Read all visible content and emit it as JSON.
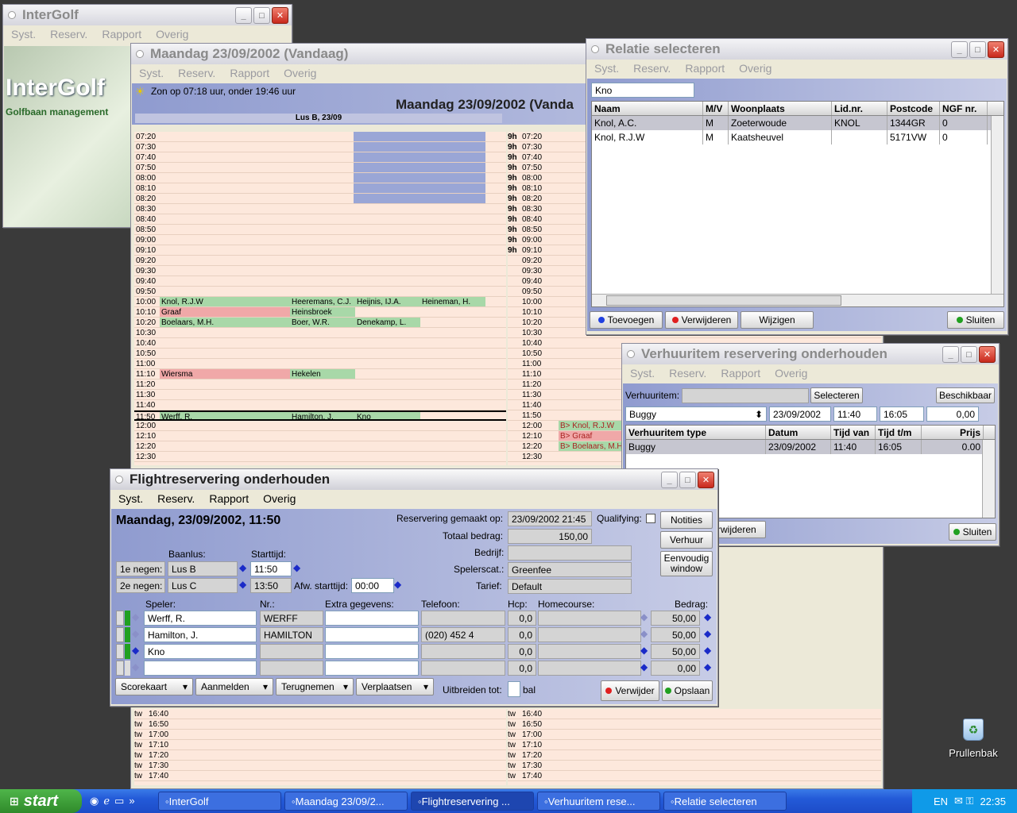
{
  "intergolf": {
    "title": "InterGolf",
    "menu": [
      "Syst.",
      "Reserv.",
      "Rapport",
      "Overig"
    ],
    "brand": "InterGolf",
    "tagline": "Golfbaan management"
  },
  "day": {
    "title": "Maandag 23/09/2002 (Vandaag)",
    "menu": [
      "Syst.",
      "Reserv.",
      "Rapport",
      "Overig"
    ],
    "sun": "Zon op 07:18 uur, onder 19:46 uur",
    "heading": "Maandag 23/09/2002 (Vanda",
    "lus_header": "Lus B, 23/09",
    "left_rows": [
      {
        "t": "07:20",
        "c": []
      },
      {
        "t": "07:30",
        "c": []
      },
      {
        "t": "07:40",
        "c": []
      },
      {
        "t": "07:50",
        "c": []
      },
      {
        "t": "08:00",
        "c": []
      },
      {
        "t": "08:10",
        "c": []
      },
      {
        "t": "08:20",
        "c": []
      },
      {
        "t": "08:30",
        "c": []
      },
      {
        "t": "08:40",
        "c": []
      },
      {
        "t": "08:50",
        "c": []
      },
      {
        "t": "09:00",
        "c": []
      },
      {
        "t": "09:10",
        "c": []
      },
      {
        "t": "09:20",
        "c": []
      },
      {
        "t": "09:30",
        "c": []
      },
      {
        "t": "09:40",
        "c": []
      },
      {
        "t": "09:50",
        "c": []
      },
      {
        "t": "10:00",
        "c": [
          "Knol, R.J.W",
          "Heeremans, C.J.",
          "Heijnis, IJ.A.",
          "Heineman, H."
        ]
      },
      {
        "t": "10:10",
        "c": [
          "Graaf",
          "Heinsbroek",
          "",
          ""
        ]
      },
      {
        "t": "10:20",
        "c": [
          "Boelaars, M.H.",
          "Boer, W.R.",
          "Denekamp, L.",
          ""
        ]
      },
      {
        "t": "10:30",
        "c": []
      },
      {
        "t": "10:40",
        "c": []
      },
      {
        "t": "10:50",
        "c": []
      },
      {
        "t": "11:00",
        "c": []
      },
      {
        "t": "11:10",
        "c": [
          "Wiersma",
          "Hekelen",
          "",
          ""
        ]
      },
      {
        "t": "11:20",
        "c": []
      },
      {
        "t": "11:30",
        "c": []
      },
      {
        "t": "11:40",
        "c": []
      },
      {
        "t": "11:50",
        "c": [
          "Werff, R.",
          "Hamilton, J.",
          "Kno",
          ""
        ]
      },
      {
        "t": "12:00",
        "c": []
      },
      {
        "t": "12:10",
        "c": []
      },
      {
        "t": "12:20",
        "c": []
      },
      {
        "t": "12:30",
        "c": []
      }
    ],
    "right_rows": [
      {
        "p": "9h",
        "t": "07:20",
        "n": ""
      },
      {
        "p": "9h",
        "t": "07:30",
        "n": ""
      },
      {
        "p": "9h",
        "t": "07:40",
        "n": ""
      },
      {
        "p": "9h",
        "t": "07:50",
        "n": ""
      },
      {
        "p": "9h",
        "t": "08:00",
        "n": ""
      },
      {
        "p": "9h",
        "t": "08:10",
        "n": ""
      },
      {
        "p": "9h",
        "t": "08:20",
        "n": ""
      },
      {
        "p": "9h",
        "t": "08:30",
        "n": ""
      },
      {
        "p": "9h",
        "t": "08:40",
        "n": ""
      },
      {
        "p": "9h",
        "t": "08:50",
        "n": ""
      },
      {
        "p": "9h",
        "t": "09:00",
        "n": ""
      },
      {
        "p": "9h",
        "t": "09:10",
        "n": ""
      },
      {
        "p": "",
        "t": "09:20",
        "n": ""
      },
      {
        "p": "",
        "t": "09:30",
        "n": ""
      },
      {
        "p": "",
        "t": "09:40",
        "n": ""
      },
      {
        "p": "",
        "t": "09:50",
        "n": ""
      },
      {
        "p": "",
        "t": "10:00",
        "n": ""
      },
      {
        "p": "",
        "t": "10:10",
        "n": ""
      },
      {
        "p": "",
        "t": "10:20",
        "n": ""
      },
      {
        "p": "",
        "t": "10:30",
        "n": ""
      },
      {
        "p": "",
        "t": "10:40",
        "n": ""
      },
      {
        "p": "",
        "t": "10:50",
        "n": ""
      },
      {
        "p": "",
        "t": "11:00",
        "n": ""
      },
      {
        "p": "",
        "t": "11:10",
        "n": ""
      },
      {
        "p": "",
        "t": "11:20",
        "n": ""
      },
      {
        "p": "",
        "t": "11:30",
        "n": ""
      },
      {
        "p": "",
        "t": "11:40",
        "n": ""
      },
      {
        "p": "",
        "t": "11:50",
        "n": ""
      },
      {
        "p": "",
        "t": "12:00",
        "n": "B> Knol, R.J.W"
      },
      {
        "p": "",
        "t": "12:10",
        "n": "B> Graaf"
      },
      {
        "p": "",
        "t": "12:20",
        "n": "B> Boelaars, M.H."
      },
      {
        "p": "",
        "t": "12:30",
        "n": ""
      }
    ],
    "bottom_rows": [
      {
        "p": "tw",
        "t": "16:40"
      },
      {
        "p": "tw",
        "t": "16:50"
      },
      {
        "p": "tw",
        "t": "17:00"
      },
      {
        "p": "tw",
        "t": "17:10"
      },
      {
        "p": "tw",
        "t": "17:20"
      },
      {
        "p": "tw",
        "t": "17:30"
      },
      {
        "p": "tw",
        "t": "17:40"
      }
    ]
  },
  "relatie": {
    "title": "Relatie selecteren",
    "menu": [
      "Syst.",
      "Reserv.",
      "Rapport",
      "Overig"
    ],
    "search": "Kno",
    "columns": [
      "Naam",
      "M/V",
      "Woonplaats",
      "Lid.nr.",
      "Postcode",
      "NGF nr."
    ],
    "rows": [
      [
        "Knol, A.C.",
        "M",
        "Zoeterwoude",
        "KNOL",
        "1344GR",
        "0"
      ],
      [
        "Knol, R.J.W",
        "M",
        "Kaatsheuvel",
        "",
        "5171VW",
        "0"
      ]
    ],
    "buttons": {
      "add": "Toevoegen",
      "remove": "Verwijderen",
      "edit": "Wijzigen",
      "close": "Sluiten"
    }
  },
  "verhuur": {
    "title": "Verhuuritem reservering onderhouden",
    "menu": [
      "Syst.",
      "Reserv.",
      "Rapport",
      "Overig"
    ],
    "item_label": "Verhuuritem:",
    "select_btn": "Selecteren",
    "avail_btn": "Beschikbaar",
    "input": {
      "type": "Buggy",
      "date": "23/09/2002",
      "from": "11:40",
      "to": "16:05",
      "price": "0,00"
    },
    "columns": [
      "Verhuuritem type",
      "Datum",
      "Tijd van",
      "Tijd t/m",
      "Prijs"
    ],
    "rows": [
      [
        "Buggy",
        "23/09/2002",
        "11:40",
        "16:05",
        "0.00"
      ]
    ],
    "partial_btn": "erwijderen",
    "close": "Sluiten"
  },
  "flight": {
    "title": "Flightreservering onderhouden",
    "menu": [
      "Syst.",
      "Reserv.",
      "Rapport",
      "Overig"
    ],
    "heading": "Maandag, 23/09/2002, 11:50",
    "made_label": "Reservering gemaakt op:",
    "made": "23/09/2002 21:45",
    "qual_label": "Qualifying:",
    "total_label": "Totaal bedrag:",
    "total": "150,00",
    "company_label": "Bedrijf:",
    "company": "",
    "cat_label": "Spelerscat.:",
    "cat": "Greenfee",
    "tarief_label": "Tarief:",
    "tarief": "Default",
    "baanlus_label": "Baanlus:",
    "start_label": "Starttijd:",
    "first_label": "1e negen:",
    "first_lus": "Lus B",
    "first_time": "11:50",
    "second_label": "2e negen:",
    "second_lus": "Lus C",
    "second_time": "13:50",
    "afw_label": "Afw. starttijd:",
    "afw": "00:00",
    "side_buttons": [
      "Notities",
      "Verhuur",
      "Eenvoudig window"
    ],
    "player_cols": [
      "Speler:",
      "Nr.:",
      "Extra gegevens:",
      "Telefoon:",
      "Hcp:",
      "Homecourse:",
      "Bedrag:"
    ],
    "players": [
      {
        "name": "Werff, R.",
        "nr": "WERFF",
        "extra": "",
        "tel": "",
        "hcp": "0,0",
        "home": "",
        "amt": "50,00"
      },
      {
        "name": "Hamilton, J.",
        "nr": "HAMILTON",
        "extra": "",
        "tel": "(020) 452 4",
        "hcp": "0,0",
        "home": "",
        "amt": "50,00"
      },
      {
        "name": "Kno",
        "nr": "",
        "extra": "",
        "tel": "",
        "hcp": "0,0",
        "home": "",
        "amt": "50,00"
      },
      {
        "name": "",
        "nr": "",
        "extra": "",
        "tel": "",
        "hcp": "0,0",
        "home": "",
        "amt": "0,00"
      }
    ],
    "dropdowns": [
      "Scorekaart",
      "Aanmelden",
      "Terugnemen",
      "Verplaatsen"
    ],
    "extend_label": "Uitbreiden tot:",
    "extend_unit": "bal",
    "delete": "Verwijder",
    "save": "Opslaan"
  },
  "desktop": {
    "recycle": "Prullenbak"
  },
  "taskbar": {
    "start": "start",
    "tasks": [
      "InterGolf",
      "Maandag 23/09/2...",
      "Flightreservering ...",
      "Verhuuritem rese...",
      "Relatie selecteren"
    ],
    "lang": "EN",
    "clock": "22:35"
  },
  "colors": {
    "booked": "#a8d8a8",
    "pink": "#f0a8a8",
    "schedBg": "#fde8dc",
    "blue": "#9aa6d6"
  }
}
